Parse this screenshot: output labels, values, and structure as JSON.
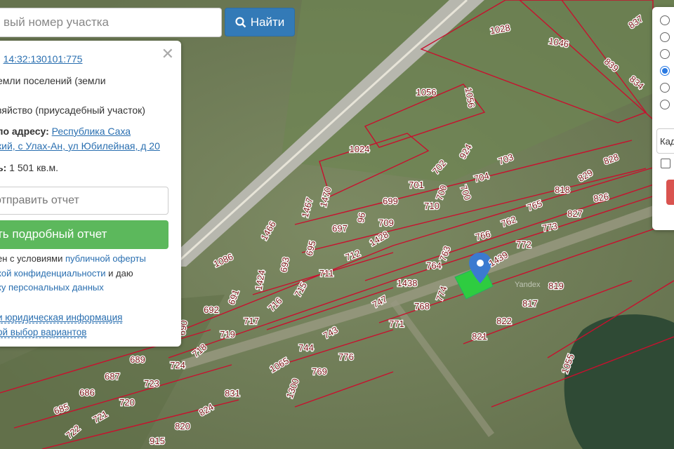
{
  "search": {
    "placeholder": "вый номер участка",
    "button_label": "Найти"
  },
  "info": {
    "cad_label": ":",
    "cad_number": "14:32:130101:775",
    "category_line": "емли поселений (земли",
    "usage_line": "зяйство (приусадебный участок)",
    "address_label": "по адресу:",
    "address_line1": "Республика Саха",
    "address_line2": "кий, с Улах-Ан, ул Юбилейная, д 20",
    "area_label": "ь:",
    "area_value": "1 501 кв.м.",
    "send_report": "отправить отчет",
    "detailed_report": "ть подробный отчет",
    "terms_1a": "ен с условиями ",
    "terms_1b": "публичной оферты",
    "terms_2a": "кой конфиденциальности",
    "terms_2b": " и даю",
    "terms_3": "ку персональных данных",
    "legal_info": " и юридическая информация",
    "variants": "ой выбор вариантов"
  },
  "right_panel": {
    "cad_input": "Кад"
  },
  "map": {
    "watermark": "Yandex",
    "parcels": [
      "1028",
      "1046",
      "837",
      "839",
      "834",
      "1056",
      "1056",
      "1024",
      "924",
      "702",
      "703",
      "701",
      "700",
      "700",
      "704",
      "699",
      "1470",
      "1467",
      "710",
      "96",
      "697",
      "709",
      "1428",
      "1466",
      "695",
      "712",
      "693",
      "1086",
      "711",
      "1424",
      "691",
      "715",
      "716",
      "692",
      "690",
      "717",
      "719",
      "718",
      "689",
      "687",
      "724",
      "723",
      "686",
      "685",
      "720",
      "721",
      "722",
      "820",
      "824",
      "831",
      "1065",
      "744",
      "743",
      "776",
      "769",
      "1300",
      "747",
      "1438",
      "764",
      "763",
      "766",
      "762",
      "765",
      "818",
      "829",
      "828",
      "826",
      "827",
      "773",
      "772",
      "1439",
      "768",
      "774",
      "771",
      "821",
      "822",
      "817",
      "819",
      "1055",
      "915"
    ]
  },
  "colors": {
    "parcel_border": "#c8102e",
    "selected_parcel": "#2ecc40",
    "marker": "#3b7ad0",
    "button_blue": "#337ab7",
    "button_green": "#5cb85c"
  }
}
